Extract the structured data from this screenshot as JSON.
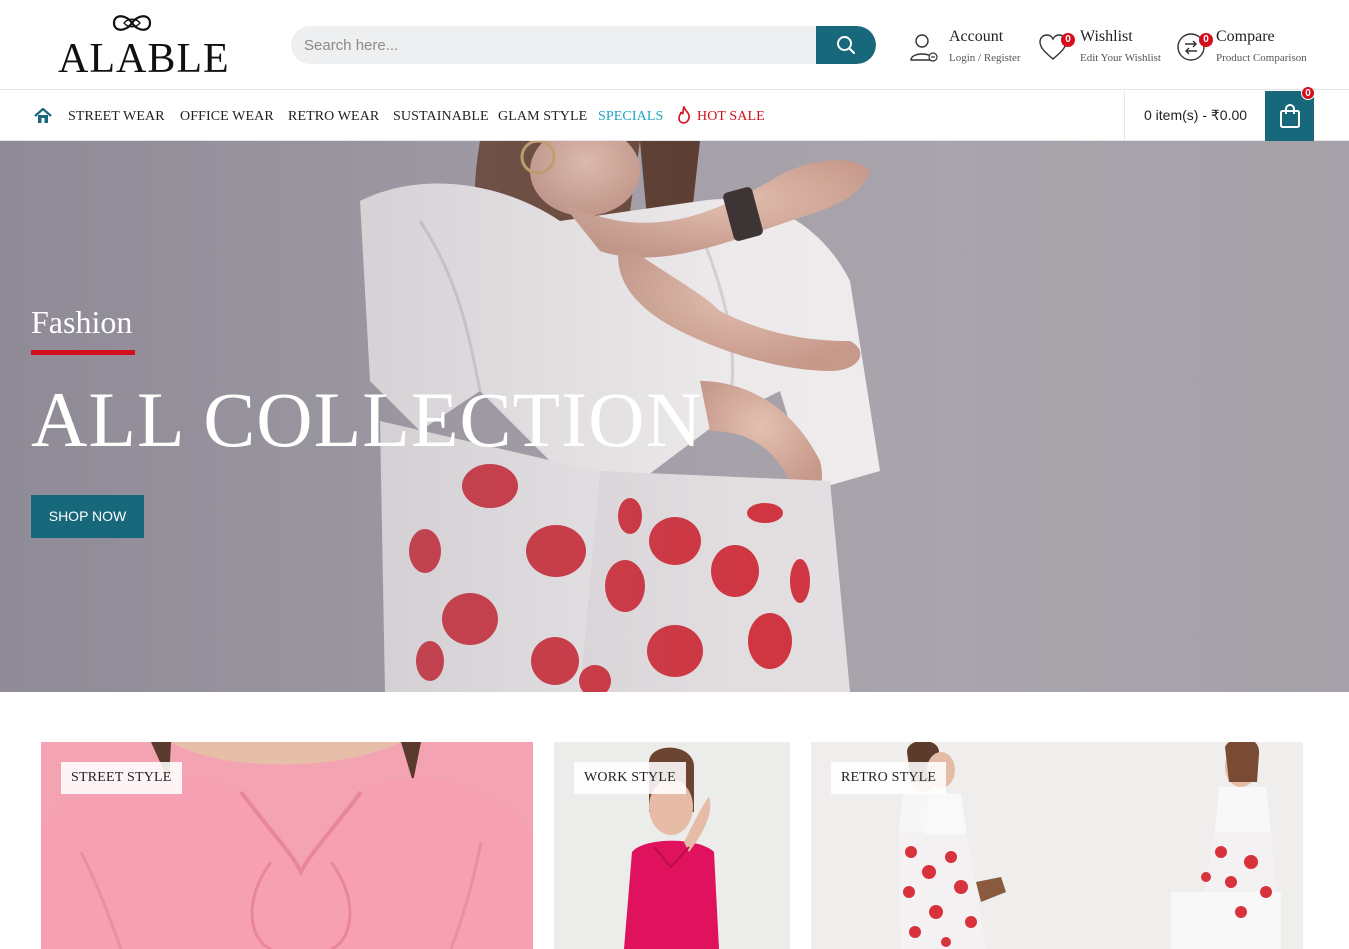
{
  "logo": {
    "text": "ALABLE"
  },
  "search": {
    "placeholder": "Search here..."
  },
  "account": {
    "title": "Account",
    "subtitle": "Login / Register"
  },
  "wishlist": {
    "title": "Wishlist",
    "subtitle": "Edit Your Wishlist",
    "count": "0"
  },
  "compare": {
    "title": "Compare",
    "subtitle": "Product Comparison",
    "count": "0"
  },
  "nav": {
    "items": [
      {
        "label": "STREET WEAR"
      },
      {
        "label": "OFFICE WEAR"
      },
      {
        "label": "RETRO WEAR"
      },
      {
        "label": "SUSTAINABLE"
      },
      {
        "label": "GLAM STYLE"
      },
      {
        "label": "SPECIALS"
      },
      {
        "label": "HOT SALE"
      }
    ]
  },
  "cart": {
    "summary": "0 item(s) - ₹0.00",
    "count": "0"
  },
  "hero": {
    "kicker": "Fashion",
    "title": "ALL COLLECTION",
    "button": "SHOP NOW"
  },
  "categories": [
    {
      "label": "STREET STYLE"
    },
    {
      "label": "WORK STYLE"
    },
    {
      "label": "RETRO STYLE"
    }
  ],
  "colors": {
    "accent": "#17687a",
    "sale": "#d40f1d",
    "special": "#1fa3c2"
  }
}
